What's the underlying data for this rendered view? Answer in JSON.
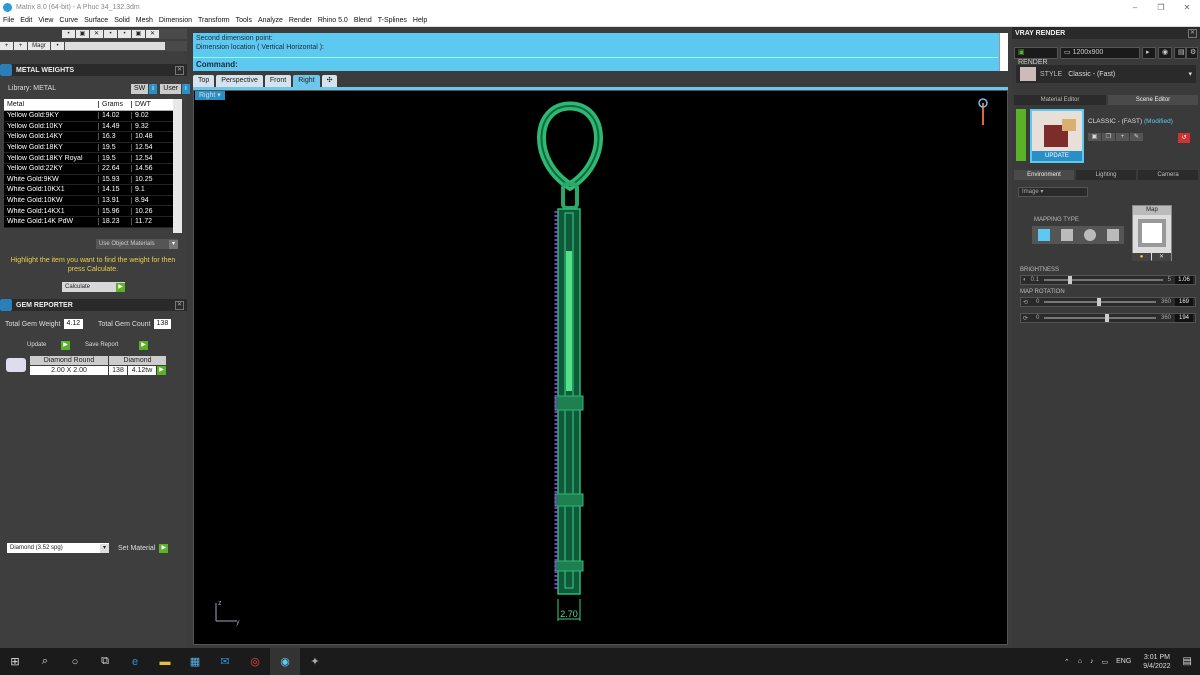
{
  "window": {
    "title": "Matrix 8.0 (64-bit) - A Phuc 34_132.3dm"
  },
  "menu": [
    "File",
    "Edit",
    "View",
    "Curve",
    "Surface",
    "Solid",
    "Mesh",
    "Dimension",
    "Transform",
    "Tools",
    "Analyze",
    "Render",
    "Rhino 5.0",
    "Blend",
    "T-Splines",
    "Help"
  ],
  "toolbar": {
    "magic_label": "Magr"
  },
  "metal_weights": {
    "title": "METAL WEIGHTS",
    "library_label": "Library: METAL",
    "sw_label": "SW",
    "user_label": "User",
    "columns": [
      "Metal",
      "Grams",
      "DWT"
    ],
    "rows": [
      [
        "Yellow Gold:9KY",
        "14.02",
        "9.02"
      ],
      [
        "Yellow Gold:10KY",
        "14.49",
        "9.32"
      ],
      [
        "Yellow Gold:14KY",
        "16.3",
        "10.48"
      ],
      [
        "Yellow Gold:18KY",
        "19.5",
        "12.54"
      ],
      [
        "Yellow Gold:18KY Royal",
        "19.5",
        "12.54"
      ],
      [
        "Yellow Gold:22KY",
        "22.64",
        "14.56"
      ],
      [
        "White Gold:9KW",
        "15.93",
        "10.25"
      ],
      [
        "White Gold:10KX1",
        "14.15",
        "9.1"
      ],
      [
        "White Gold:10KW",
        "13.91",
        "8.94"
      ],
      [
        "White Gold:14KX1",
        "15.96",
        "10.26"
      ],
      [
        "White Gold:14K PdW",
        "18.23",
        "11.72"
      ]
    ],
    "use_object_materials": "Use Object Materials",
    "note": "Highlight the item you want to find the weight for then press Calculate.",
    "calculate": "Calculate"
  },
  "gem_reporter": {
    "title": "GEM REPORTER",
    "total_weight_label": "Total Gem Weight",
    "total_weight": "4.12",
    "total_count_label": "Total Gem Count",
    "total_count": "138",
    "update": "Update",
    "save_report": "Save Report",
    "gem_cut": "Diamond Round",
    "gem_type": "Diamond",
    "gem_size": "2.00 X 2.00",
    "gem_count": "138",
    "gem_weight": "4.12tw"
  },
  "material": {
    "selected": "Diamond    (3.52 spg)",
    "set_material": "Set Material"
  },
  "command": {
    "line1": "Second dimension point:",
    "line2": "Dimension location ( Vertical  Horizontal ):",
    "prompt": "Command:"
  },
  "viewport_tabs": [
    "Top",
    "Perspective",
    "Front",
    "Right"
  ],
  "viewport": {
    "label": "Right",
    "dimension": "2.70",
    "axis_z": "z",
    "axis_y": "y"
  },
  "vray": {
    "title": "VRAY RENDER",
    "render": "RENDER",
    "resolution": "1200x900",
    "style_label": "STYLE",
    "style_value": "Classic - (Fast)",
    "tabs_top": [
      "Material Editor",
      "Scene Editor"
    ],
    "scene_name": "CLASSIC - (FAST)",
    "modified": "(Modified)",
    "update": "UPDATE",
    "tabs_env": [
      "Environment",
      "Lighting",
      "Camera"
    ],
    "env_select": "Image",
    "mapping_type": "MAPPING TYPE",
    "map_label": "Map",
    "brightness_label": "BRIGHTNESS",
    "brightness_min": "0.1",
    "brightness_max": "5",
    "brightness_val": "1.06",
    "brightness_frac": 0.2,
    "map_rotation_label": "MAP ROTATION",
    "rot1_min": "0",
    "rot1_max": "360",
    "rot1_val": "169",
    "rot1_frac": 0.47,
    "rot2_min": "0",
    "rot2_max": "360",
    "rot2_val": "194",
    "rot2_frac": 0.54
  },
  "taskbar": {
    "lang": "ENG",
    "time": "3:01 PM",
    "date": "9/4/2022"
  }
}
